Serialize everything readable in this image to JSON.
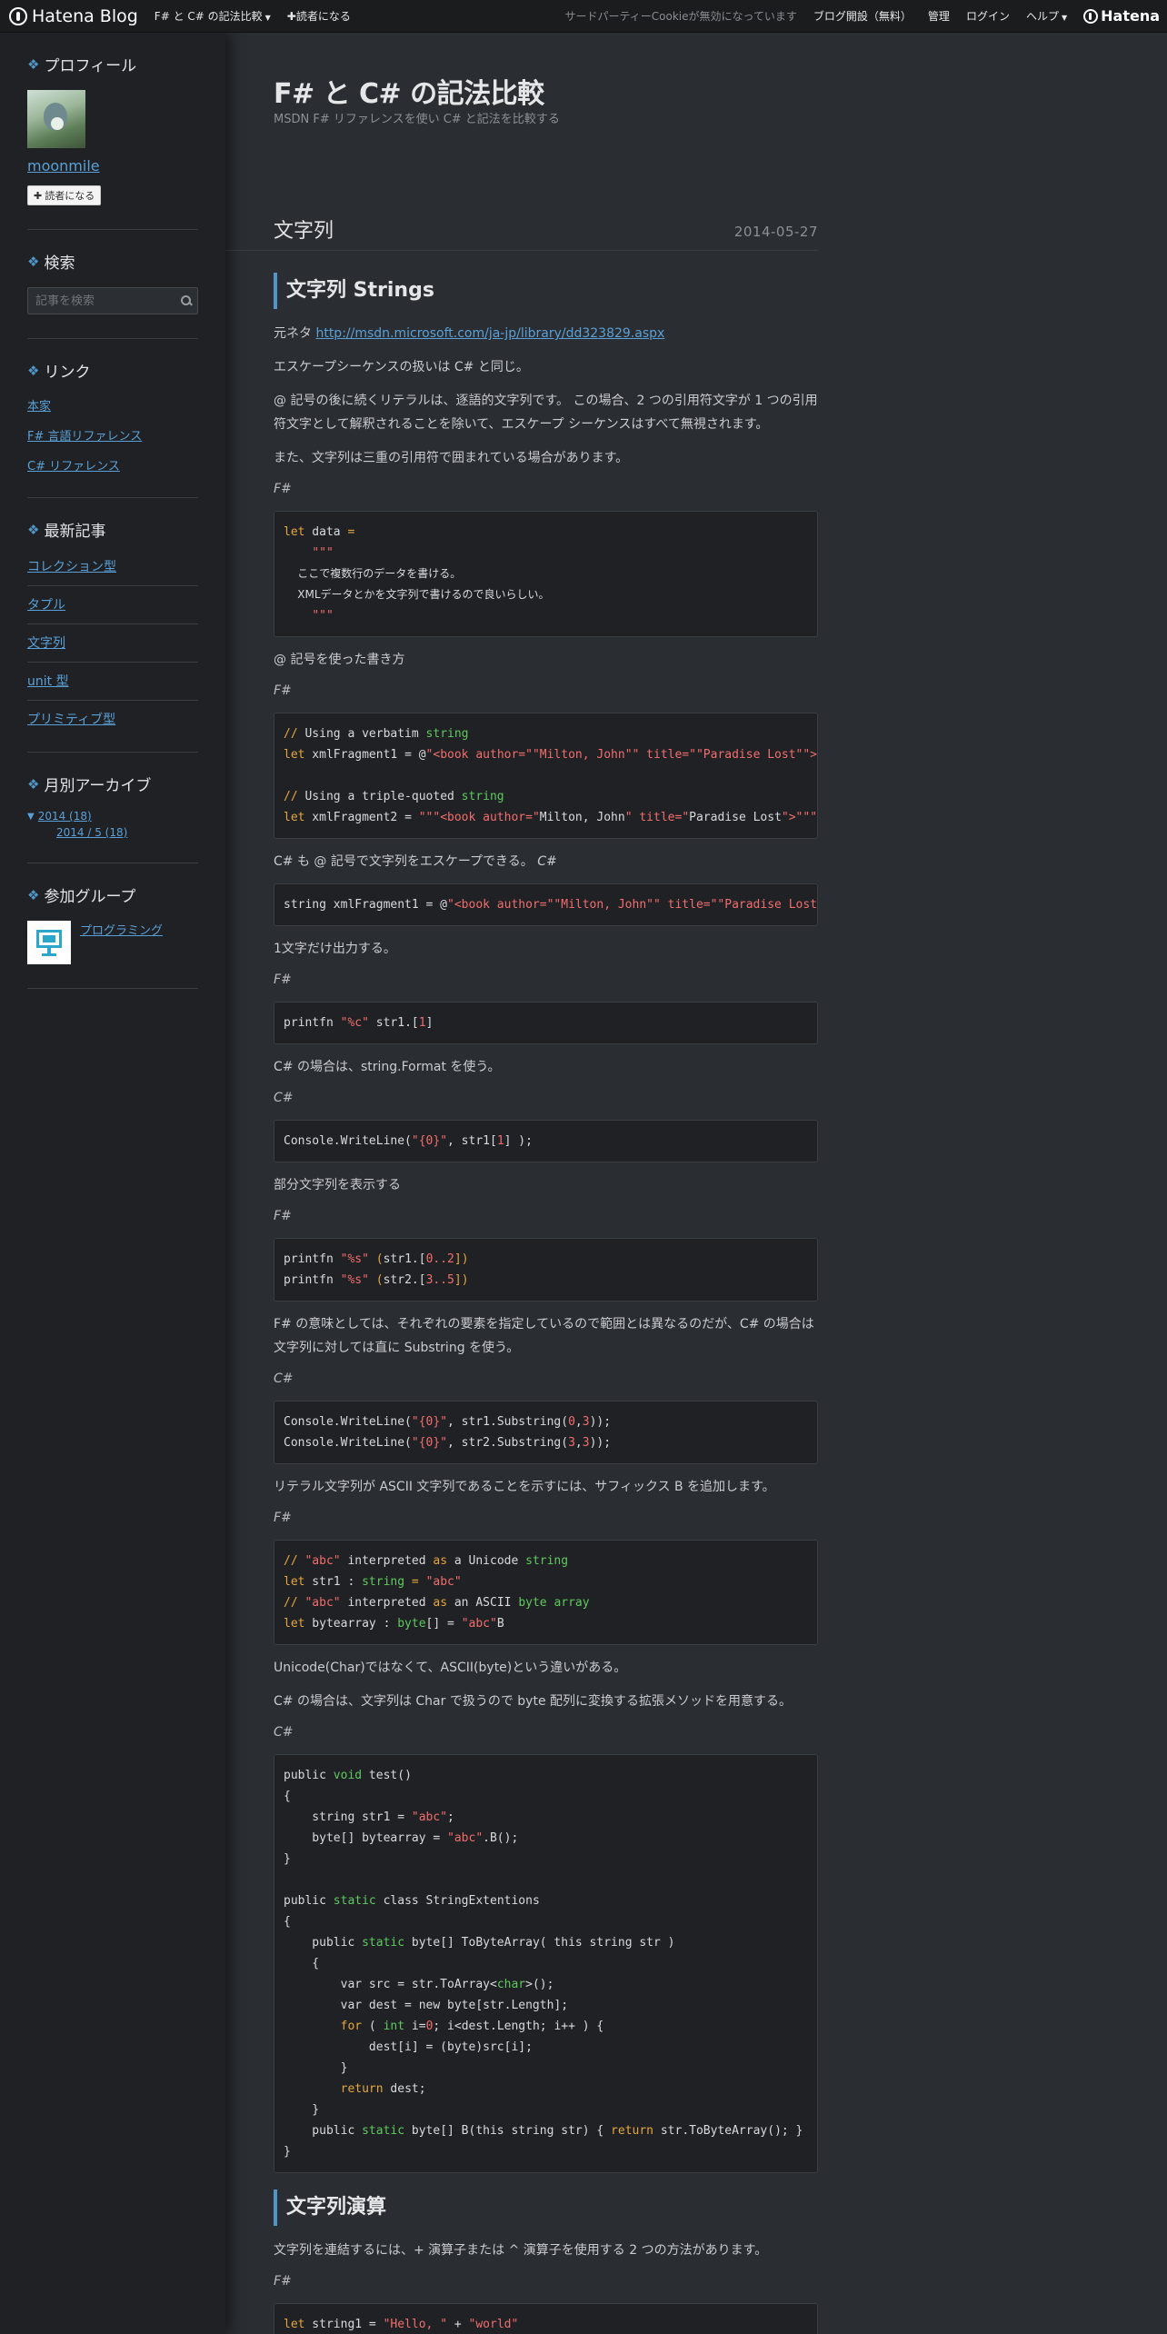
{
  "topbar": {
    "brand": "Hatena Blog",
    "blog_menu": "F# と C# の記法比較",
    "follow": "読者になる",
    "cookie_notice": "サードパーティーCookieが無効になっています",
    "open_blog": "ブログ開設（無料）",
    "admin": "管理",
    "login": "ログイン",
    "help": "ヘルプ",
    "hatena": "Hatena"
  },
  "sidebar": {
    "profile_title": "プロフィール",
    "profile_name": "moonmile",
    "follow_button": "読者になる",
    "search_title": "検索",
    "search_placeholder": "記事を検索",
    "links_title": "リンク",
    "links": [
      "本家",
      "F# 言語リファレンス",
      "C# リファレンス"
    ],
    "recent_title": "最新記事",
    "recent": [
      "コレクション型",
      "タプル",
      "文字列",
      "unit 型",
      "プリミティブ型"
    ],
    "archive_title": "月別アーカイブ",
    "archive_year": "2014 (18)",
    "archive_month": "2014 / 5 (18)",
    "groups_title": "参加グループ",
    "group_name": "プログラミング"
  },
  "blog": {
    "title": "F# と C# の記法比較",
    "description": "MSDN F# リファレンスを使い C# と記法を比較する"
  },
  "entry": {
    "title": "文字列",
    "date": "2014-05-27",
    "h_strings": "文字列 Strings",
    "ref_prefix": "元ネタ ",
    "ref_url": "http://msdn.microsoft.com/ja-jp/library/dd323829.aspx",
    "p1": "エスケープシーケンスの扱いは C# と同じ。",
    "p2": "@ 記号の後に続くリテラルは、逐語的文字列です。 この場合、2 つの引用符文字が 1 つの引用符文字として解釈されることを除いて、エスケープ シーケンスはすべて無視されます。",
    "p3": "また、文字列は三重の引用符で囲まれている場合があります。",
    "lang_fs": "F#",
    "lang_cs": "C#",
    "p4": "@ 記号を使った書き方",
    "p5": "C# も @ 記号で文字列をエスケープできる。",
    "p6": "1文字だけ出力する。",
    "p7": "C# の場合は、string.Format を使う。",
    "p8": "部分文字列を表示する",
    "p9": "F# の意味としては、それぞれの要素を指定しているので範囲とは異なるのだが、C# の場合は文字列に対しては直に Substring を使う。",
    "p10": "リテラル文字列が ASCII 文字列であることを示すには、サフィックス B を追加します。",
    "p11": "Unicode(Char)ではなくて、ASCII(byte)という違いがある。",
    "p12": "C# の場合は、文字列は Char で扱うので byte 配列に変換する拡張メソッドを用意する。",
    "h_ops": "文字列演算",
    "p13": "文字列を連結するには、+ 演算子または ^ 演算子を使用する 2 つの方法があります。"
  },
  "code": {
    "c1": {
      "l1a": "let",
      "l1b": " data ",
      "l1c": "=",
      "l2": "\"\"\"",
      "l3": "ここで複数行のデータを書ける。",
      "l4": "XMLデータとかを文字列で書けるので良いらしい。",
      "l5": "\"\"\""
    },
    "c2": {
      "l1a": "// ",
      "l1b": "Using a verbatim ",
      "l1c": "string",
      "l2a": "let",
      "l2b": " xmlFragment1 ",
      "l2c": "= @",
      "l2d": "\"<book author=\"\"Milton, John\"\" title=\"\"Paradise Lost\"\">\"",
      "l4a": "// ",
      "l4b": "Using a triple-quoted ",
      "l4c": "string",
      "l5a": "let",
      "l5b": " xmlFragment2 ",
      "l5c": "=",
      "l5d": " \"\"\"<book author=\"",
      "l5e": "Milton, John",
      "l5f": "\" title=\"",
      "l5g": "Paradise Lost",
      "l5h": "\">\"\"\""
    },
    "c3": {
      "a": "string xmlFragment1 = @",
      "b": "\"<book author=\"\"Milton, John\"\" title=\"\"Paradise Lost\"\">\"",
      "c": ";"
    },
    "c4": {
      "a": "printfn ",
      "b": "\"%c\"",
      "c": " str1.[",
      "d": "1",
      "e": "]"
    },
    "c5": {
      "a": "Console.WriteLine(",
      "b": "\"{0}\"",
      "c": ", str1[",
      "d": "1",
      "e": "] );"
    },
    "c6": {
      "l1a": "printfn ",
      "l1b": "\"%s\"",
      "l1c": " (",
      "l1d": "str1.[",
      "l1e": "0..2",
      "l1f": "])",
      "l2a": "printfn ",
      "l2b": "\"%s\"",
      "l2c": " (",
      "l2d": "str2.[",
      "l2e": "3..5",
      "l2f": "])"
    },
    "c7": {
      "l1a": "Console.WriteLine(",
      "l1b": "\"{0}\"",
      "l1c": ", str1.Substring(",
      "l1d": "0",
      "l1e": ",",
      "l1f": "3",
      "l1g": "));",
      "l2a": "Console.WriteLine(",
      "l2b": "\"{0}\"",
      "l2c": ", str2.Substring(",
      "l2d": "3",
      "l2e": ",",
      "l2f": "3",
      "l2g": "));"
    },
    "c8": {
      "l1a": "// ",
      "l1b": "\"abc\"",
      "l1c": " interpreted ",
      "l1d": "as",
      "l1e": " a Unicode ",
      "l1f": "string",
      "l2a": "let",
      "l2b": " str1 : ",
      "l2c": "string",
      "l2d": " = ",
      "l2e": "\"abc\"",
      "l3a": "// ",
      "l3b": "\"abc\"",
      "l3c": " interpreted ",
      "l3d": "as",
      "l3e": " an ASCII ",
      "l3f": "byte array",
      "l4a": "let",
      "l4b": " bytearray : ",
      "l4c": "byte",
      "l4d": "[] = ",
      "l4e": "\"abc\"",
      "l4f": "B"
    },
    "c9": {
      "l1a": "public ",
      "l1b": "void",
      "l1c": " test()",
      "l2": "{",
      "l3a": "    string str1 = ",
      "l3b": "\"abc\"",
      "l3c": ";",
      "l4a": "    byte[] bytearray = ",
      "l4b": "\"abc\"",
      "l4c": ".B();",
      "l5": "}",
      "l7a": "public ",
      "l7b": "static",
      "l7c": " class StringExtentions",
      "l8": "{",
      "l9a": "    public ",
      "l9b": "static",
      "l9c": " byte[] ToByteArray( this string str )",
      "l10": "    {",
      "l11a": "        var src = str.ToArray<",
      "l11b": "char",
      "l11c": ">();",
      "l12": "        var dest = new byte[str.Length];",
      "l13a": "        ",
      "l13b": "for",
      "l13c": " ( ",
      "l13d": "int",
      "l13e": " i=",
      "l13f": "0",
      "l13g": "; i<dest.Length; i++ ) {",
      "l14": "            dest[i] = (byte)src[i];",
      "l15": "        }",
      "l16a": "        ",
      "l16b": "return",
      "l16c": " dest;",
      "l17": "    }",
      "l18a": "    public ",
      "l18b": "static",
      "l18c": " byte[] B(this string str) { ",
      "l18d": "return",
      "l18e": " str.ToByteArray(); }",
      "l19": "}"
    },
    "c10": {
      "a": "let",
      "b": " string1 = ",
      "c": "\"Hello, \"",
      "d": " + ",
      "e": "\"world\""
    }
  }
}
